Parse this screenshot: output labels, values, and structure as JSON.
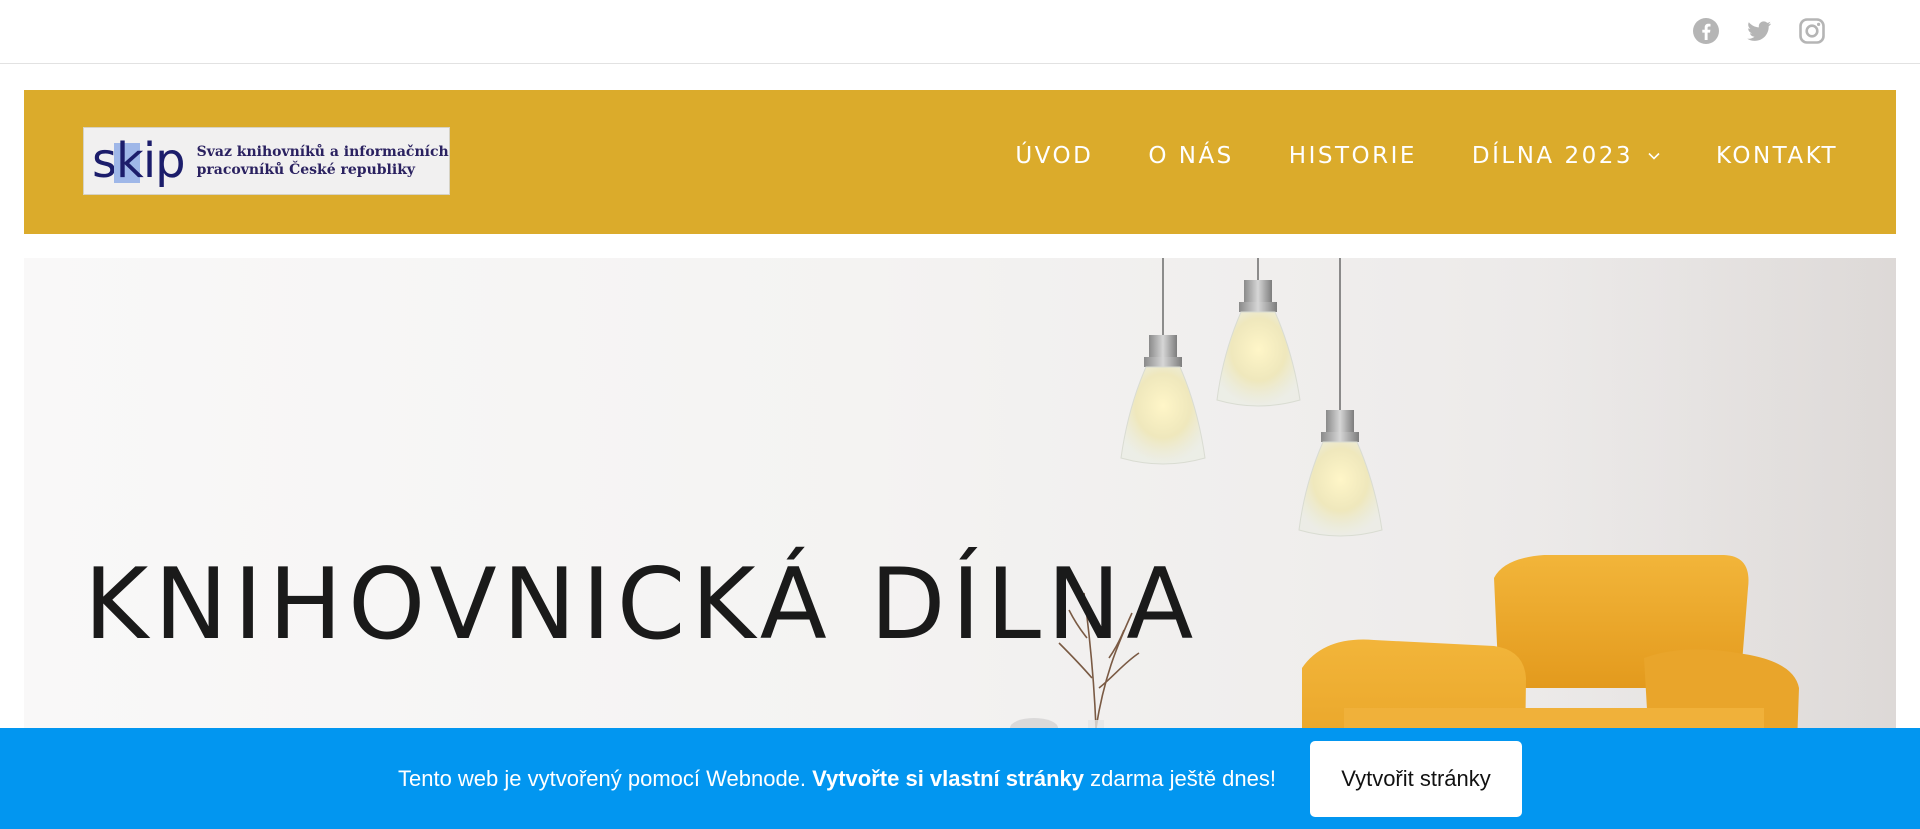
{
  "social": {
    "icons": [
      "facebook-icon",
      "twitter-icon",
      "instagram-icon"
    ],
    "color": "#b5b5b5"
  },
  "header": {
    "background": "#dbab2b",
    "logo": {
      "mark": "skip",
      "line1": "Svaz knihovníků a informačních",
      "line2": "pracovníků České republiky"
    },
    "nav": [
      {
        "label": "ÚVOD"
      },
      {
        "label": "O NÁS"
      },
      {
        "label": "HISTORIE"
      },
      {
        "label": "DÍLNA 2023",
        "has_dropdown": true
      },
      {
        "label": "KONTAKT"
      }
    ]
  },
  "hero": {
    "title": "KNIHOVNICKÁ DÍLNA"
  },
  "promo": {
    "background": "#0296f0",
    "text_before": "Tento web je vytvořený pomocí Webnode. ",
    "text_bold": "Vytvořte si vlastní stránky",
    "text_after": " zdarma ještě dnes!",
    "button_label": "Vytvořit stránky"
  }
}
